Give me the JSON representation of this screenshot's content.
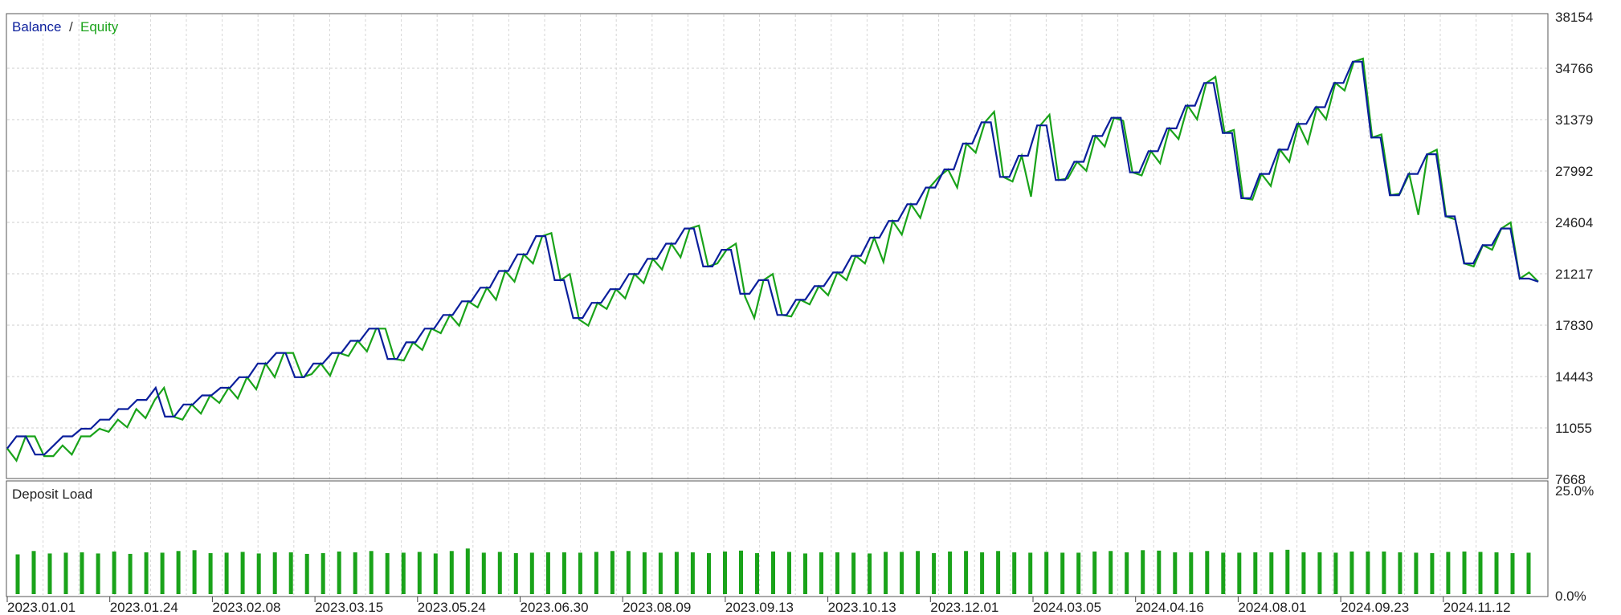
{
  "chart_data": [
    {
      "type": "line",
      "legend": {
        "items": [
          "Balance",
          "Equity"
        ],
        "separator": "/",
        "placement": "top-left"
      },
      "series": [
        {
          "name": "Balance",
          "color": "#0b1f9c",
          "values": [
            9700,
            10500,
            10500,
            9300,
            9300,
            9900,
            10500,
            10500,
            11000,
            11000,
            11600,
            11600,
            12300,
            12300,
            12900,
            12900,
            13700,
            11800,
            11800,
            12600,
            12600,
            13200,
            13200,
            13700,
            13700,
            14400,
            14400,
            15300,
            15300,
            16000,
            16000,
            14400,
            14400,
            15300,
            15300,
            16000,
            16000,
            16800,
            16800,
            17600,
            17600,
            15600,
            15600,
            16700,
            16700,
            17600,
            17600,
            18500,
            18500,
            19400,
            19400,
            20300,
            20300,
            21400,
            21400,
            22500,
            22500,
            23700,
            23700,
            20800,
            20800,
            18300,
            18300,
            19300,
            19300,
            20200,
            20200,
            21200,
            21200,
            22200,
            22200,
            23200,
            23200,
            24200,
            24200,
            21700,
            21700,
            22800,
            22800,
            19900,
            19900,
            20800,
            20800,
            18500,
            18500,
            19500,
            19500,
            20400,
            20400,
            21300,
            21300,
            22400,
            22400,
            23600,
            23600,
            24700,
            24700,
            25800,
            25800,
            26900,
            26900,
            28100,
            28100,
            29800,
            29800,
            31200,
            31200,
            27600,
            27600,
            29000,
            29000,
            31000,
            31000,
            27400,
            27400,
            28600,
            28600,
            30300,
            30300,
            31500,
            31500,
            27900,
            27900,
            29300,
            29300,
            30800,
            30800,
            32300,
            32300,
            33800,
            33800,
            30500,
            30500,
            26200,
            26200,
            27800,
            27800,
            29400,
            29400,
            31100,
            31100,
            32200,
            32200,
            33800,
            33800,
            35200,
            35200,
            30200,
            30200,
            26400,
            26400,
            27800,
            27800,
            29100,
            29100,
            25000,
            25000,
            21900,
            21900,
            23100,
            23100,
            24200,
            24200,
            20900,
            20900,
            20700
          ]
        },
        {
          "name": "Equity",
          "color": "#1aa31a",
          "values": [
            9700,
            8900,
            10500,
            10500,
            9200,
            9200,
            9900,
            9300,
            10500,
            10500,
            11000,
            10800,
            11600,
            11100,
            12300,
            11700,
            12900,
            13700,
            11800,
            11600,
            12600,
            12000,
            13200,
            12700,
            13700,
            13000,
            14400,
            13600,
            15300,
            14400,
            16000,
            16000,
            14400,
            14600,
            15300,
            14500,
            16000,
            15800,
            16800,
            16100,
            17600,
            17600,
            15600,
            15500,
            16700,
            16200,
            17600,
            17300,
            18500,
            17800,
            19400,
            19000,
            20300,
            19500,
            21400,
            20700,
            22500,
            21900,
            23700,
            23900,
            20800,
            21200,
            18200,
            17800,
            19300,
            18900,
            20200,
            19600,
            21200,
            20600,
            22200,
            21500,
            23200,
            22300,
            24200,
            24400,
            21700,
            21900,
            22800,
            23200,
            19700,
            18300,
            20800,
            21200,
            18500,
            18400,
            19500,
            19200,
            20400,
            19800,
            21300,
            20800,
            22400,
            21900,
            23600,
            22000,
            24700,
            23800,
            25800,
            24900,
            26900,
            27600,
            28100,
            26900,
            29800,
            29200,
            31200,
            31900,
            27600,
            27300,
            29000,
            26300,
            31000,
            31700,
            27400,
            27500,
            28600,
            28000,
            30300,
            29600,
            31500,
            31300,
            27900,
            27700,
            29300,
            28500,
            30800,
            30100,
            32300,
            31400,
            33800,
            34200,
            30500,
            30700,
            26200,
            26100,
            27800,
            27000,
            29400,
            28600,
            31100,
            29800,
            32200,
            31400,
            33800,
            33300,
            35200,
            35400,
            30200,
            30400,
            26400,
            26500,
            27800,
            25100,
            29100,
            29400,
            25000,
            24800,
            21900,
            21700,
            23100,
            22800,
            24200,
            24600,
            20900,
            21300,
            20700
          ]
        }
      ],
      "x_tick_labels": [
        "2023.01.01",
        "2023.01.24",
        "2023.02.08",
        "2023.03.15",
        "2023.05.24",
        "2023.06.30",
        "2023.08.09",
        "2023.09.13",
        "2023.10.13",
        "2023.12.01",
        "2024.03.05",
        "2024.04.16",
        "2024.08.01",
        "2024.09.23",
        "2024.11.12"
      ],
      "y_tick_labels": [
        "38154",
        "34766",
        "31379",
        "27992",
        "24604",
        "21217",
        "17830",
        "14443",
        "11055",
        "7668"
      ],
      "ylim": [
        7668,
        38154
      ],
      "grid": true
    },
    {
      "type": "bar",
      "title": "Deposit Load",
      "color": "#1aa31a",
      "y_tick_labels": [
        "25.0%",
        "0.0%"
      ],
      "ylim": [
        0,
        25
      ],
      "values": [
        9.6,
        10.4,
        9.8,
        10.0,
        10.1,
        9.8,
        10.3,
        9.7,
        10.1,
        10.0,
        10.4,
        10.6,
        9.9,
        10.0,
        10.2,
        9.8,
        10.1,
        10.1,
        9.7,
        9.9,
        10.3,
        10.1,
        10.4,
        9.9,
        10.0,
        10.2,
        9.8,
        10.4,
        11.0,
        10.0,
        10.2,
        9.9,
        10.0,
        10.1,
        10.1,
        10.0,
        10.2,
        10.4,
        10.4,
        10.1,
        10.0,
        10.2,
        10.1,
        9.9,
        10.3,
        10.5,
        9.9,
        10.3,
        10.2,
        9.8,
        10.1,
        10.1,
        10.0,
        9.8,
        10.2,
        10.2,
        10.4,
        9.9,
        10.3,
        10.4,
        10.1,
        10.4,
        10.1,
        10.0,
        10.2,
        10.0,
        10.0,
        10.3,
        10.4,
        10.1,
        10.6,
        10.5,
        10.1,
        10.1,
        10.4,
        10.0,
        10.0,
        10.1,
        10.1,
        10.7,
        10.1,
        10.1,
        10.0,
        10.3,
        10.3,
        10.3,
        10.1,
        10.0,
        9.9,
        10.2,
        10.3,
        10.2,
        10.1,
        9.9,
        10.0
      ]
    }
  ]
}
